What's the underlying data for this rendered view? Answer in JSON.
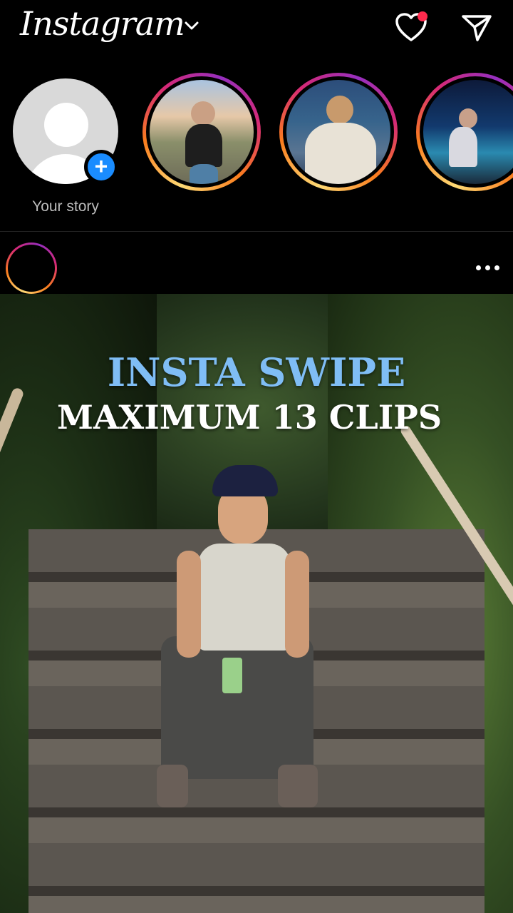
{
  "app": {
    "title": "Instagram"
  },
  "header": {
    "icons": [
      "chevron-down-icon",
      "heart-icon",
      "send-icon"
    ],
    "notification_color": "#ff2a4d"
  },
  "stories": {
    "own_label": "Your story",
    "items": [
      {
        "icon": "avatar"
      },
      {
        "icon": "avatar"
      },
      {
        "icon": "avatar"
      }
    ]
  },
  "post": {
    "overlay_line1": "INSTA SWIPE",
    "overlay_line2": "MAXIMUM 13 CLIPS",
    "menu_icon": "more-icon"
  },
  "colors": {
    "accent_blue": "#1a8cff",
    "overlay_blue": "#7fbdf5",
    "story_ring": [
      "#feda75",
      "#fa7e1e",
      "#d62976",
      "#962fbf"
    ]
  }
}
